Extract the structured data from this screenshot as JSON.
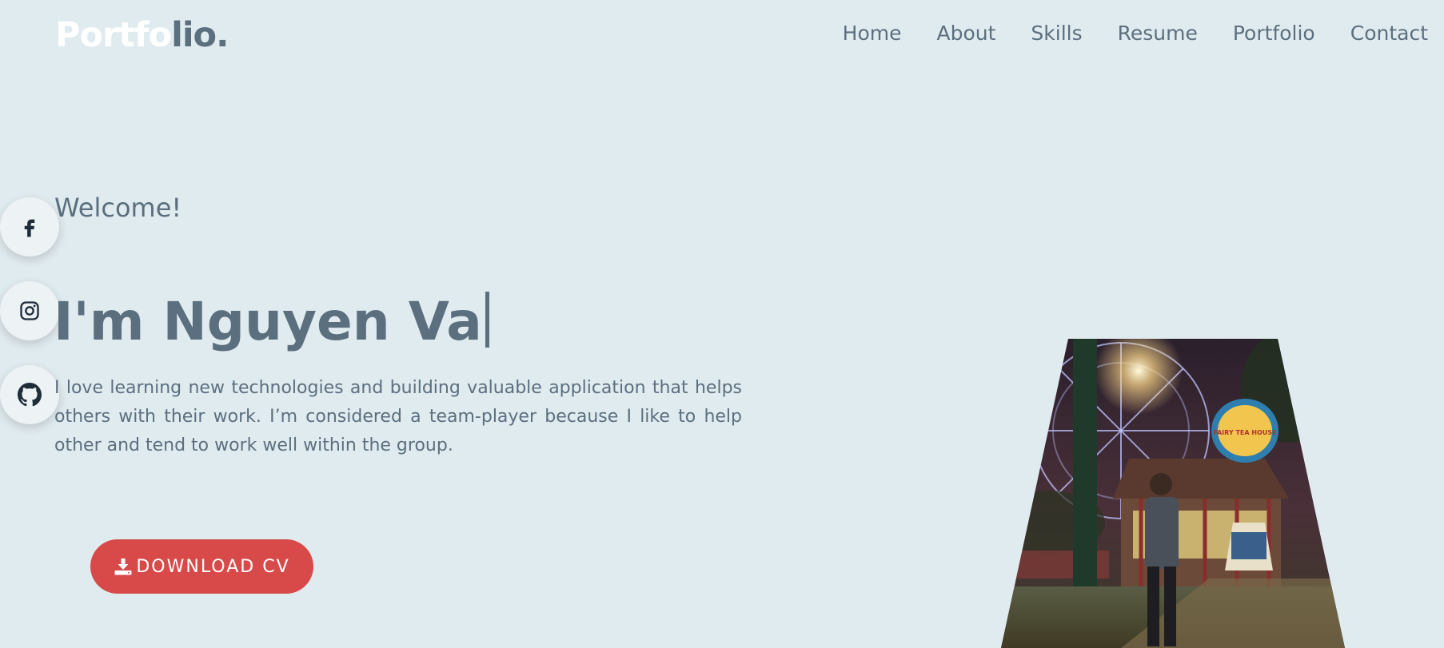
{
  "header": {
    "logo_primary": "Portfo",
    "logo_secondary": "lio."
  },
  "nav": {
    "items": [
      "Home",
      "About",
      "Skills",
      "Resume",
      "Portfolio",
      "Contact"
    ]
  },
  "social": {
    "icons": [
      "facebook-icon",
      "instagram-icon",
      "github-icon"
    ]
  },
  "hero": {
    "welcome": "Welcome!",
    "headline": "I'm Nguyen Va",
    "description": "I love learning new technologies and building valuable application that helps others with their work. I’m considered a team-player because I like to help other and tend to work well within the group.",
    "cv_button_label": "DOWNLOAD CV",
    "cv_button_icon": "download-icon",
    "photo_sign": "FAIRY TEA HOUSE"
  },
  "colors": {
    "background": "#e0ebef",
    "text": "#5b6f7f",
    "accent": "#d84a4a",
    "logo_primary": "#ffffff"
  }
}
